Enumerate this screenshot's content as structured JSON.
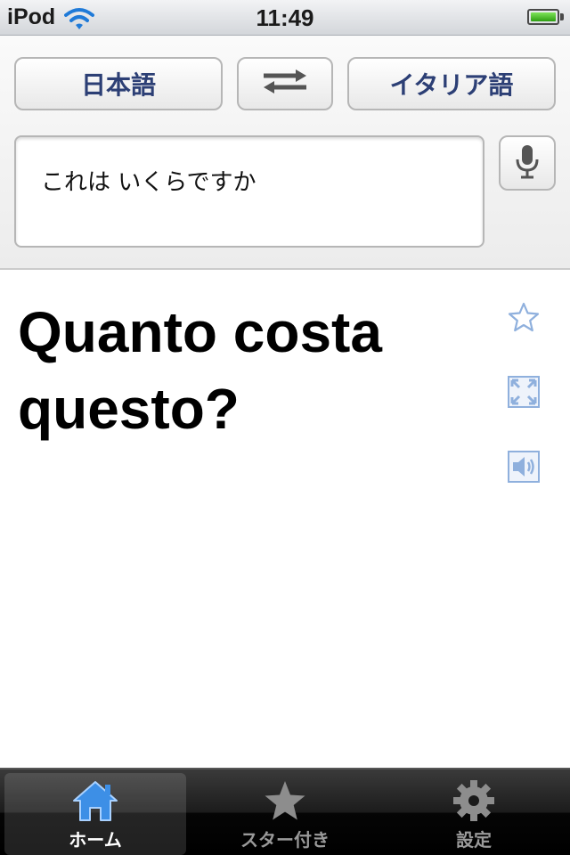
{
  "status_bar": {
    "carrier": "iPod",
    "time": "11:49",
    "battery_level": 1.0
  },
  "toolbar": {
    "source_language": "日本語",
    "target_language": "イタリア語"
  },
  "input": {
    "value": "これは いくらですか"
  },
  "result": {
    "translation": "Quanto costa questo?"
  },
  "tabs": [
    {
      "label": "ホーム",
      "icon": "home-icon",
      "active": true
    },
    {
      "label": "スター付き",
      "icon": "star-icon",
      "active": false
    },
    {
      "label": "設定",
      "icon": "gear-icon",
      "active": false
    }
  ],
  "colors": {
    "accent": "#2c3f75",
    "icon_blue": "#8fb0dd",
    "tab_active_icon": "#3d8fe6"
  }
}
